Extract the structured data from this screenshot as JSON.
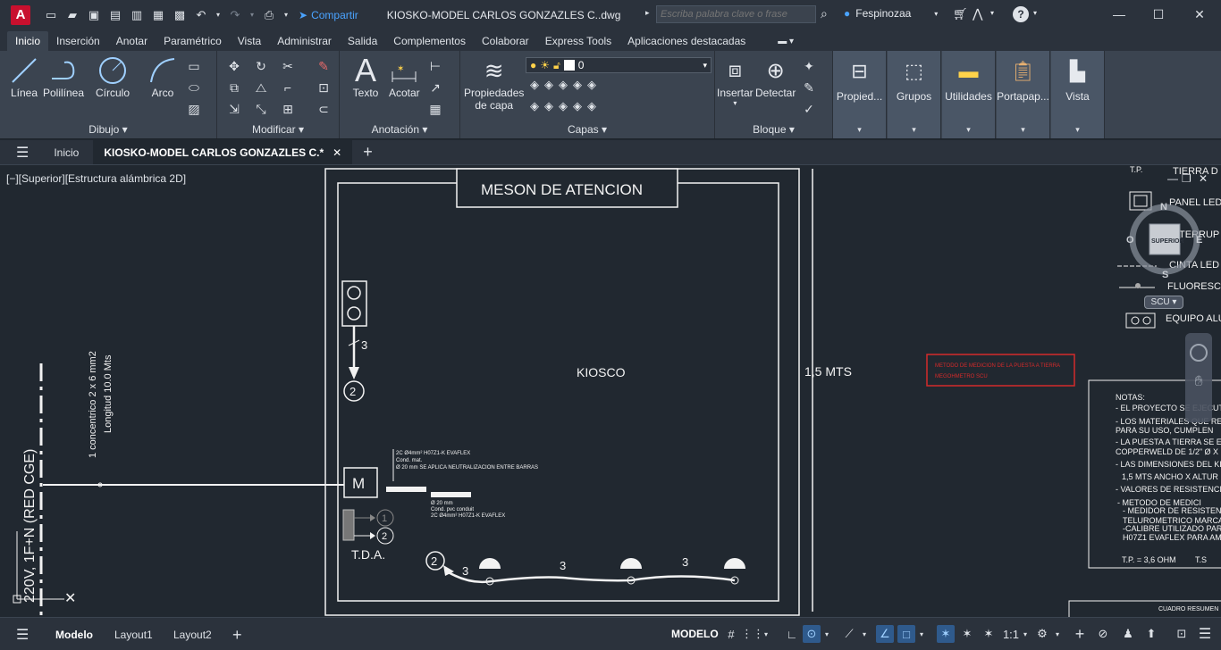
{
  "titlebar": {
    "app_letter": "A",
    "share_label": "Compartir",
    "doc_title": "KIOSKO-MODEL CARLOS GONZAZLES C..dwg",
    "search_placeholder": "Escriba palabra clave o frase",
    "user": "Fespinozaa"
  },
  "ribbon_tabs": [
    "Inicio",
    "Inserción",
    "Anotar",
    "Paramétrico",
    "Vista",
    "Administrar",
    "Salida",
    "Complementos",
    "Colaborar",
    "Express Tools",
    "Aplicaciones destacadas"
  ],
  "ribbon": {
    "draw": {
      "title": "Dibujo",
      "line": "Línea",
      "polyline": "Polilínea",
      "circle": "Círculo",
      "arc": "Arco"
    },
    "modify": {
      "title": "Modificar"
    },
    "annotation": {
      "title": "Anotación",
      "text": "Texto",
      "dimension": "Acotar"
    },
    "layers": {
      "title": "Capas",
      "layer_props": "Propiedades",
      "layer_props2": "de capa",
      "current_layer": "0"
    },
    "block": {
      "title": "Bloque",
      "insert": "Insertar",
      "detect": "Detectar"
    },
    "properties": "Propied...",
    "groups": "Grupos",
    "utilities": "Utilidades",
    "clipboard": "Portapap...",
    "view": "Vista"
  },
  "filetabs": {
    "home": "Inicio",
    "drawing": "KIOSKO-MODEL CARLOS GONZAZLES C.*"
  },
  "viewport": {
    "label": "[−][Superior][Estructura alámbrica 2D]"
  },
  "drawing": {
    "title_box": "MESON  DE ATENCION",
    "kiosk_label": "KIOSCO",
    "dimension": "1,5 MTS",
    "tda": "T.D.A.",
    "meter": "M",
    "circuit_num_3": "3",
    "circuit_2": "2",
    "circuit_1": "1",
    "supply_vertical": "220V, 1F+N (RED CGE)",
    "cable_line1": "1 concentrico 2 x 6 mm2",
    "cable_line2": "Longitud 10.0 Mts",
    "note_a": "2C Ø4mm² H07Z1-K EVAFLEX",
    "note_b": "Cond. mat.",
    "note_c": "Ø 20 mm SE APLICA NEUTRALIZACION ENTRE BARRAS",
    "note_d": "Ø 20 mm",
    "note_e": "Cond. pvc conduit",
    "note_f": "2C Ø4mm² H07Z1-K EVAFLEX",
    "red_note1": "METODO DE MEDICION DE LA PUESTA A TIERRA",
    "red_note2": "MEGOHMETRO SCU",
    "legend": [
      "TIERRA D",
      "PANEL LED",
      "INTERRUP",
      "CINTA LED",
      "FLUORESC",
      "EQUIPO ALU"
    ],
    "legend_tp": "T.P.",
    "notes_title": "NOTAS:",
    "notes": [
      "- EL PROYECTO SE EJECUT",
      "- LOS MATERIALES QUE RE",
      "  PARA SU USO, CUMPLEN",
      "- LA PUESTA A TIERRA SE E",
      "  COPPERWELD DE 1/2\" Ø X",
      "- LAS DIMENSIONES DEL KI",
      "  1,5 MTS ANCHO X ALTUR",
      "- VALORES DE RESISTENCIA",
      "  - METODO DE MEDICI",
      "  - MEDIDOR DE RESISTEN",
      "    TELUROMETRICO MARCA",
      "  -CALIBRE UTILIZADO PAR",
      "    H07Z1 EVAFLEX PARA AM"
    ],
    "tp_value": "T.P. = 3,6 OHM",
    "ts_value": "T.S",
    "cuadro": "CUADRO RESUMEN"
  },
  "viewcube": {
    "face": "SUPERIOR",
    "north": "N",
    "south": "S",
    "east": "E",
    "west": "O",
    "ucs": "SCU"
  },
  "statusbar": {
    "layouts": [
      "Modelo",
      "Layout1",
      "Layout2"
    ],
    "model": "MODELO",
    "scale": "1:1"
  }
}
